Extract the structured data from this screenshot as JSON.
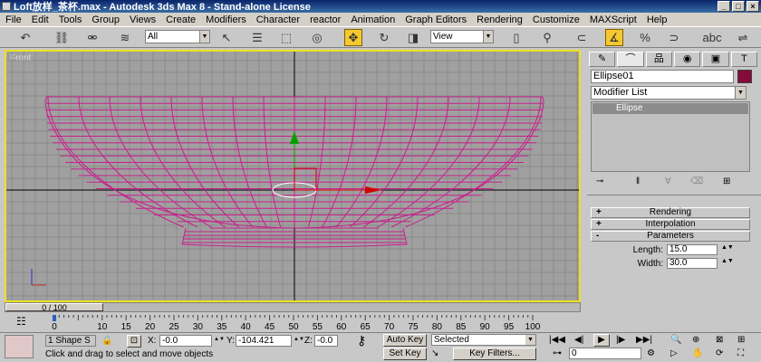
{
  "window": {
    "title": "Loft放样_茶杯.max - Autodesk 3ds Max 8 - Stand-alone License"
  },
  "menu": [
    "File",
    "Edit",
    "Tools",
    "Group",
    "Views",
    "Create",
    "Modifiers",
    "Character",
    "reactor",
    "Animation",
    "Graph Editors",
    "Rendering",
    "Customize",
    "MAXScript",
    "Help"
  ],
  "toolbar": {
    "selection_filter": "All",
    "reference_coord": "View",
    "active_tool": "select-and-move",
    "icon_names": [
      "undo-icon",
      "link-icon",
      "unlink-icon",
      "bind-spacewarp-icon",
      "select-icon",
      "select-by-name-icon",
      "rect-region-icon",
      "window-crossing-icon",
      "move-icon",
      "rotate-icon",
      "scale-icon",
      "use-pivot-icon",
      "mirror-icon",
      "align-icon",
      "angle-snap-icon",
      "percent-snap-icon",
      "spinner-snap-icon",
      "named-selection-icon"
    ]
  },
  "viewport": {
    "label": "Front",
    "accent": "#f0e020"
  },
  "command_panel": {
    "tabs": [
      "create",
      "modify",
      "hierarchy",
      "motion",
      "display",
      "utilities"
    ],
    "object_name": "Ellipse01",
    "object_color": "#870a3c",
    "modifier_list": "Modifier List",
    "stack_item": "Ellipse",
    "rollouts": [
      {
        "sign": "+",
        "label": "Rendering"
      },
      {
        "sign": "+",
        "label": "Interpolation"
      },
      {
        "sign": "-",
        "label": "Parameters"
      }
    ],
    "params": [
      {
        "label": "Length:",
        "value": "15.0"
      },
      {
        "label": "Width:",
        "value": "30.0"
      }
    ]
  },
  "timeline": {
    "frame_display": "0 / 100",
    "ticks": [
      "0",
      "10",
      "15",
      "20",
      "25",
      "30",
      "35",
      "40",
      "45",
      "50",
      "55",
      "60",
      "65",
      "70",
      "75",
      "80",
      "85",
      "90",
      "95",
      "100"
    ]
  },
  "status": {
    "selection_count": "1 Shape S",
    "x_label": "X:",
    "x_value": "-0.0",
    "y_label": "Y:",
    "y_value": "-104.421",
    "z_label": "Z:",
    "z_value": "-0.0",
    "auto_key": "Auto Key",
    "set_key": "Set Key",
    "key_mode": "Selected",
    "key_filters": "Key Filters...",
    "current_frame": "0",
    "prompt": "Click and drag to select and move objects"
  }
}
